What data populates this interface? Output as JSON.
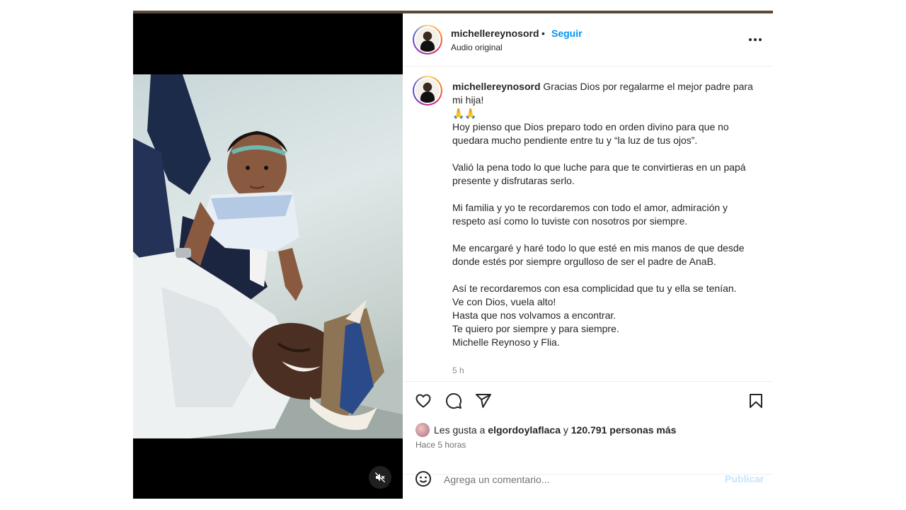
{
  "post": {
    "username": "michellereynosord",
    "follow_separator": "•",
    "follow_label": "Seguir",
    "audio_label": "Audio original"
  },
  "caption": {
    "username": "michellereynosord",
    "line1": "Gracias Dios por regalarme el mejor padre para mi hija!",
    "emoji": "🙏🙏",
    "para1": "Hoy pienso que Dios preparo todo en orden divino para que no quedara mucho pendiente entre tu y “la luz de tus ojos”.",
    "para2": "Valió la pena todo lo que luche para que te convirtieras en un papá presente y disfrutaras serlo.",
    "para3": "Mi familia y yo te recordaremos con todo el amor, admiración y respeto así como lo tuviste con nosotros por siempre.",
    "para4": "Me encargaré y haré todo lo que esté en mis manos de que desde donde estés por siempre orgulloso de ser el padre de AnaB.",
    "closing": [
      "Así te recordaremos con esa complicidad que tu y ella se tenían.",
      "Ve con Dios, vuela alto!",
      "Hasta que nos volvamos a encontrar.",
      "Te quiero por siempre y para siempre.",
      "Michelle Reynoso y Flia."
    ],
    "time": "5 h"
  },
  "likes": {
    "prefix": "Les gusta a",
    "first_user": "elgordoylaflaca",
    "connector": "y",
    "others": "120.791 personas más",
    "ago": "Hace 5 horas"
  },
  "comment": {
    "placeholder": "Agrega un comentario...",
    "publish_label": "Publicar"
  },
  "icons": {
    "more": "more-options-icon",
    "like": "heart-icon",
    "comment": "comment-icon",
    "share": "send-icon",
    "save": "bookmark-icon",
    "emoji": "emoji-icon",
    "mute": "muted-speaker-icon"
  },
  "colors": {
    "link_blue": "#0095f6",
    "publish_disabled": "#c5e3fb",
    "secondary_text": "#737373"
  }
}
